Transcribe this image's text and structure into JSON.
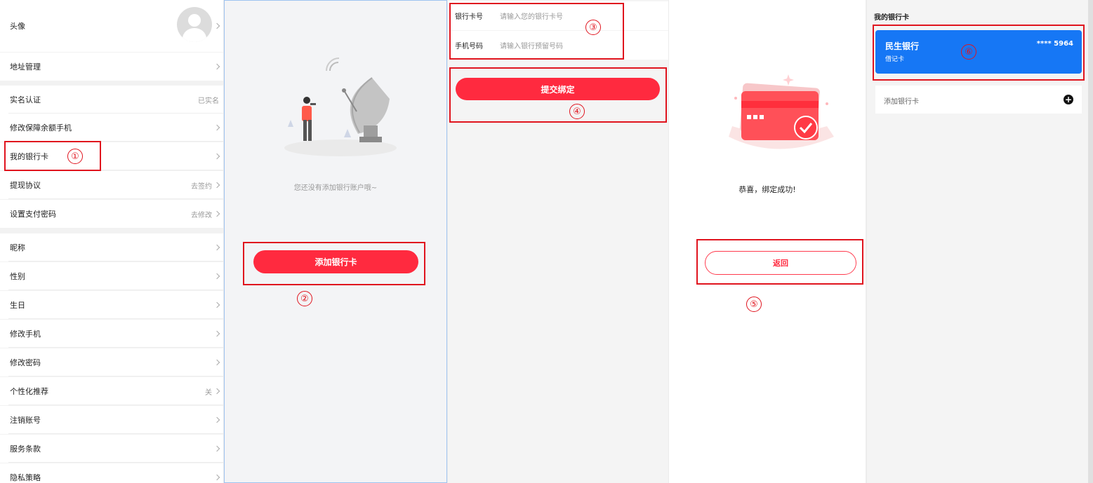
{
  "settings": {
    "avatar_label": "头像",
    "address_label": "地址管理",
    "realname_label": "实名认证",
    "realname_status": "已实名",
    "change_phone_guarantee_label": "修改保障余额手机",
    "my_bank_card_label": "我的银行卡",
    "withdraw_agreement_label": "提现协议",
    "withdraw_agreement_value": "去签约",
    "pay_password_label": "设置支付密码",
    "pay_password_value": "去修改",
    "nickname_label": "昵称",
    "gender_label": "性别",
    "birthday_label": "生日",
    "change_phone_label": "修改手机",
    "change_password_label": "修改密码",
    "personalized_label": "个性化推荐",
    "personalized_value": "关",
    "cancel_account_label": "注销账号",
    "service_terms_label": "服务条款",
    "privacy_label": "隐私策略"
  },
  "empty_card": {
    "message": "您还没有添加银行账户哦~",
    "add_button": "添加银行卡"
  },
  "bind_form": {
    "card_label": "银行卡号",
    "card_placeholder": "请输入您的银行卡号",
    "phone_label": "手机号码",
    "phone_placeholder": "请输入银行预留号码",
    "submit_button": "提交绑定"
  },
  "success": {
    "message": "恭喜，绑定成功!",
    "back_button": "返回"
  },
  "my_cards": {
    "title": "我的银行卡",
    "card": {
      "bank_name": "民生银行",
      "card_type": "借记卡",
      "number_masked": "**** 5964"
    },
    "add_label": "添加银行卡",
    "add_icon": "+"
  },
  "annotations": {
    "step1": "①",
    "step2": "②",
    "step3": "③",
    "step4": "④",
    "step5": "⑤",
    "step6": "⑥"
  },
  "colors": {
    "primary_red": "#ff2a3f",
    "annotation_red": "#e0141e",
    "card_blue": "#1677f5"
  }
}
